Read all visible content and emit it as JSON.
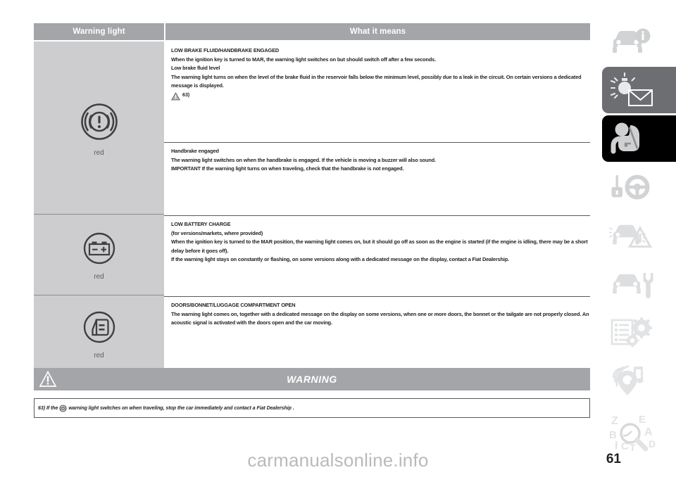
{
  "table": {
    "headers": {
      "col1": "Warning light",
      "col2": "What it means"
    },
    "rows": [
      {
        "icon": "brake-warning-light-icon",
        "color_label": "red",
        "blocks": [
          {
            "id": "low-brake-fluid",
            "lines": [
              "LOW BRAKE FLUID/HANDBRAKE ENGAGED",
              "When the ignition key is turned to MAR, the warning light switches on but should switch off after a few seconds.",
              "Low brake fluid level",
              "The warning light turns on when the level of the brake fluid in the reservoir falls below the minimum level, possibly due to a leak in the circuit. On certain versions a dedicated message is displayed."
            ],
            "reference": "63)"
          },
          {
            "id": "handbrake-engaged",
            "lines": [
              "Handbrake engaged",
              "The warning light switches on when the handbrake is engaged. If the vehicle is moving a buzzer will also sound.",
              "IMPORTANT If the warning light turns on when traveling, check that the handbrake is not engaged."
            ]
          }
        ]
      },
      {
        "icon": "battery-charge-icon",
        "color_label": "red",
        "blocks": [
          {
            "id": "low-battery-charge",
            "lines": [
              "LOW BATTERY CHARGE",
              "(for versions/markets, where provided)",
              "When the ignition key is turned to the MAR position, the warning light comes on, but it should go off as soon as the engine is started (if the engine is idling, there may be a short delay before it goes off).",
              "If the warning light stays on constantly or flashing, on some versions along with a dedicated message on the display, contact a Fiat Dealership."
            ]
          }
        ]
      },
      {
        "icon": "door-open-icon",
        "color_label": "red",
        "blocks": [
          {
            "id": "doors-open",
            "lines": [
              "DOORS/BONNET/LUGGAGE COMPARTMENT OPEN",
              "The warning light comes on, together with a dedicated message on the display on some versions, when one or more doors, the bonnet or the tailgate are not properly closed. An acoustic signal is activated with the doors open and the car moving."
            ]
          }
        ]
      }
    ]
  },
  "warning_banner": {
    "icon": "warning-triangle-icon",
    "label": "WARNING"
  },
  "warning_note": {
    "reference": "63)",
    "text_before": "If the",
    "icon": "brake-warning-light-icon",
    "text_after": "warning light switches on when traveling, stop the car immediately and contact a",
    "emphasis": "Fiat Dealership",
    "suffix": "."
  },
  "sidebar": {
    "items": [
      {
        "name": "car-info",
        "icon": "car-info-icon",
        "theme": "white"
      },
      {
        "name": "lights-and-messages",
        "icon": "bulb-envelope-icon",
        "theme": "gray"
      },
      {
        "name": "safety",
        "icon": "seatbelt-passenger-icon",
        "theme": "black"
      },
      {
        "name": "starting-and-driving",
        "icon": "key-steering-wheel-icon",
        "theme": "white"
      },
      {
        "name": "in-emergency",
        "icon": "car-hazard-triangle-icon",
        "theme": "white"
      },
      {
        "name": "maintenance-and-care",
        "icon": "car-wrench-icon",
        "theme": "white"
      },
      {
        "name": "technical-specifications",
        "icon": "list-gears-icon",
        "theme": "white"
      },
      {
        "name": "multimedia",
        "icon": "radio-music-icon",
        "theme": "white"
      },
      {
        "name": "alphabetical-index",
        "icon": "index-magnifier-icon",
        "theme": "white"
      }
    ]
  },
  "footer": {
    "watermark": "carmanualsonline.info",
    "page_number": "61"
  },
  "colors": {
    "header_gray": "#a3a5a8",
    "cell_gray": "#cdcdcf",
    "text": "#231f20",
    "rule": "#58595b",
    "sidebar_gray": "#6d6e71"
  }
}
